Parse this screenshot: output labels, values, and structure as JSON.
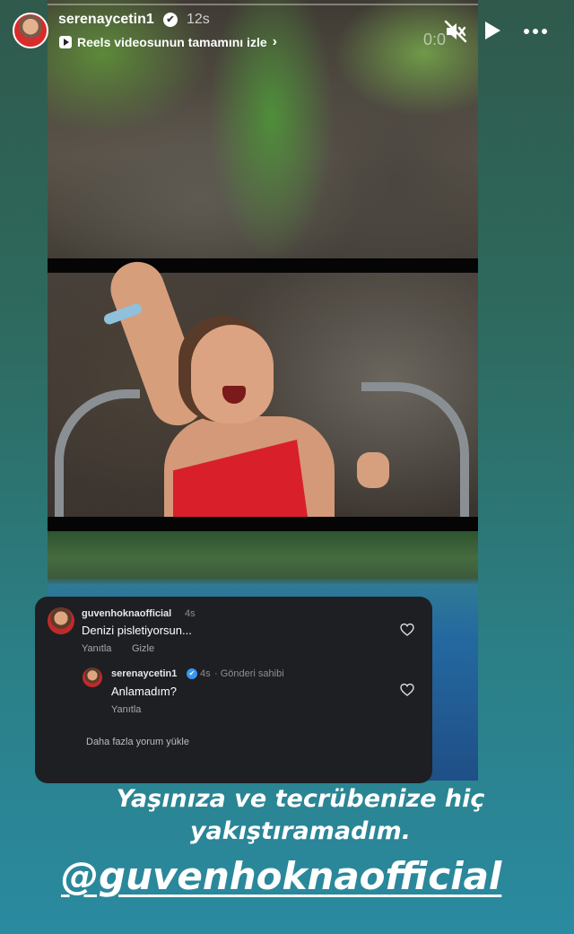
{
  "header": {
    "username": "serenaycetin1",
    "verified_mark": "✔",
    "time_ago": "12s",
    "reels_link_label": "Reels videosunun tamamını izle",
    "chevron": "›",
    "clock": "0:0",
    "icons": [
      "mute-icon",
      "play-icon",
      "more-icon",
      "verified-icon",
      "reels-icon"
    ]
  },
  "comments": {
    "first": {
      "username": "guvenhoknaofficial",
      "time": "4s",
      "text": "Denizi pisletiyorsun...",
      "reply_label": "Yanıtla",
      "hide_label": "Gizle"
    },
    "second": {
      "username": "serenaycetin1",
      "time": "4s",
      "owner_label": "· Gönderi sahibi",
      "text": "Anlamadım?",
      "reply_label": "Yanıtla"
    },
    "load_more_label": "Daha fazla yorum yükle"
  },
  "caption": {
    "line1": "Yaşınıza ve tecrübenize hiç",
    "line2": "yakıştıramadım.",
    "mention": "@guvenhoknaofficial"
  },
  "colors": {
    "panel_bg": "#1e1f23",
    "verified_blue": "#3897f0",
    "swimsuit_red": "#d9202a"
  }
}
